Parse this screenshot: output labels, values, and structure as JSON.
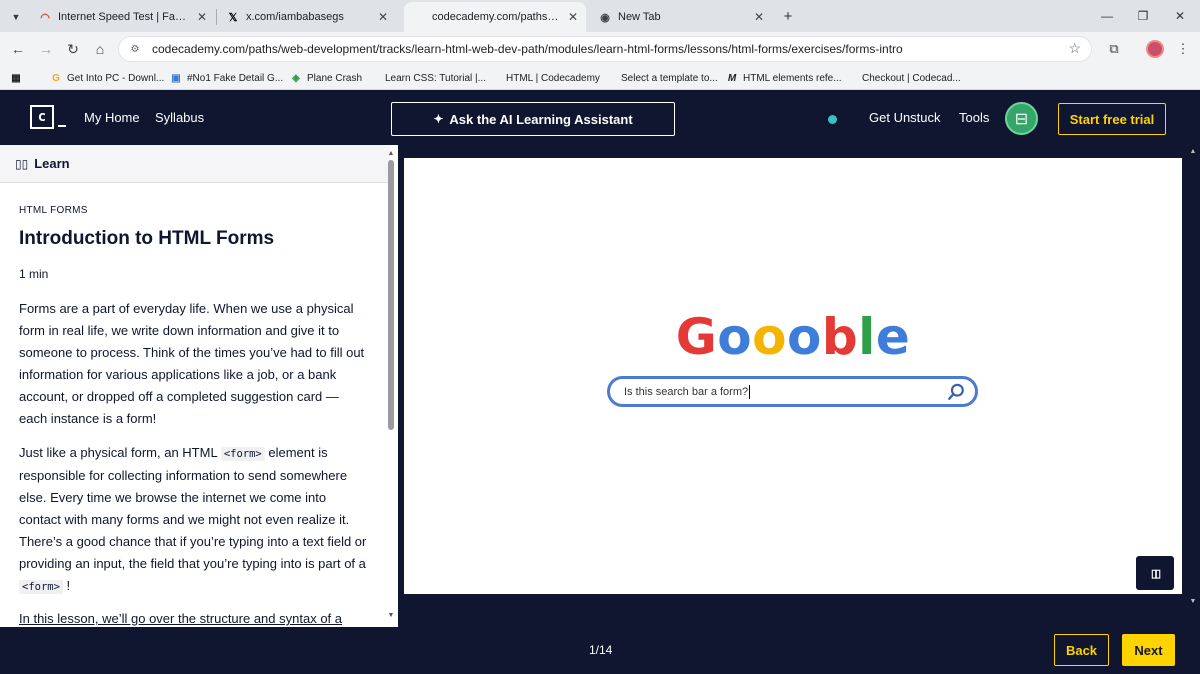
{
  "browser": {
    "tabs": [
      {
        "title": "Internet Speed Test | Fast.com",
        "active": false,
        "icon": "fast-com-icon"
      },
      {
        "title": "x.com/iambabasegs",
        "active": false,
        "icon": "x-icon"
      },
      {
        "title": "codecademy.com/paths/web-d",
        "active": true,
        "icon": "codecademy-icon"
      },
      {
        "title": "New Tab",
        "active": false,
        "icon": "chrome-icon"
      }
    ],
    "url": "codecademy.com/paths/web-development/tracks/learn-html-web-dev-path/modules/learn-html-forms/lessons/html-forms/exercises/forms-intro",
    "bookmarks": [
      {
        "label": "Get Into PC - Downl...",
        "icon": "google-icon"
      },
      {
        "label": "#No1 Fake Detail G...",
        "icon": "fake-detail-icon"
      },
      {
        "label": "Plane Crash",
        "icon": "plane-crash-icon"
      },
      {
        "label": "Learn CSS: Tutorial |...",
        "icon": "codecademy-icon"
      },
      {
        "label": "HTML | Codecademy",
        "icon": "codecademy-icon"
      },
      {
        "label": "Select a template to...",
        "icon": "page-icon"
      },
      {
        "label": "HTML elements refe...",
        "icon": "mdn-icon"
      },
      {
        "label": "Checkout | Codecad...",
        "icon": "codecademy-icon"
      }
    ]
  },
  "header": {
    "nav": {
      "home": "My Home",
      "syllabus": "Syllabus"
    },
    "ai_button": "Ask the AI Learning Assistant",
    "get_unstuck": "Get Unstuck",
    "tools": "Tools",
    "start_trial": "Start free trial"
  },
  "lesson": {
    "tab_label": "Learn",
    "kicker": "HTML FORMS",
    "title": "Introduction to HTML Forms",
    "duration": "1 min",
    "p1": "Forms are a part of everyday life. When we use a physical form in real life, we write down information and give it to someone to process. Think of the times you’ve had to fill out information for various applications like a job, or a bank account, or dropped off a completed suggestion card — each instance is a form!",
    "p2_a": "Just like a physical form, an HTML ",
    "p2_code": "<form>",
    "p2_b": " element is responsible for collecting information to send somewhere else. Every time we browse the internet we come into contact with many forms and we might not even realize it. There’s a good chance that if you’re typing into a text field or providing an input, the field that you’re typing into is part of a ",
    "p2_code2": "<form>",
    "p2_c": " !",
    "p3": "In this lesson, we’ll go over the structure and syntax of a"
  },
  "preview": {
    "logo_letters": [
      {
        "ch": "G",
        "color": "#e53935"
      },
      {
        "ch": "o",
        "color": "#3f7ddb"
      },
      {
        "ch": "o",
        "color": "#f5b400"
      },
      {
        "ch": "o",
        "color": "#3f7ddb"
      },
      {
        "ch": "b",
        "color": "#e53935"
      },
      {
        "ch": "l",
        "color": "#2e9e47"
      },
      {
        "ch": "e",
        "color": "#3f7ddb"
      }
    ],
    "search_value": "Is this search bar a form?"
  },
  "footer": {
    "progress": "1/14",
    "back": "Back",
    "next": "Next"
  },
  "colors": {
    "navy": "#10162f",
    "yellow": "#ffd300",
    "search_border": "#4a7bd0"
  }
}
